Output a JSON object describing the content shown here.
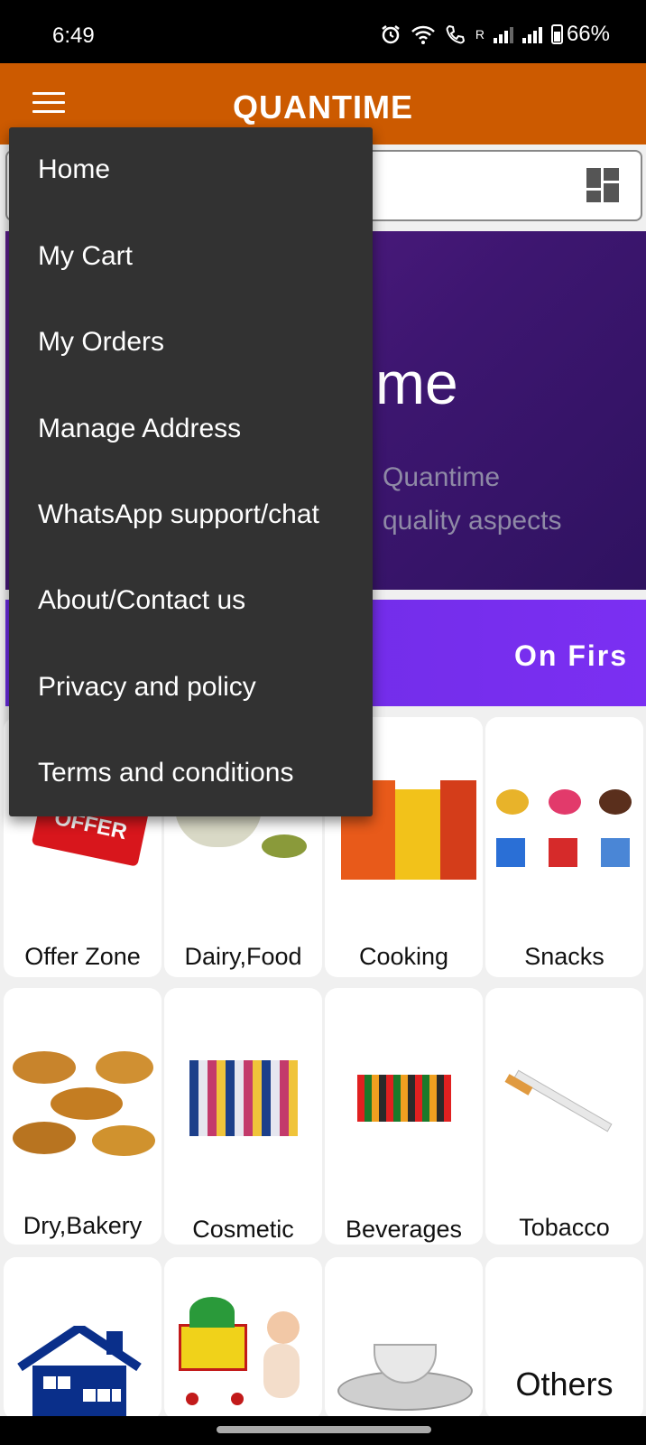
{
  "status_bar": {
    "time": "6:49",
    "net_label": "R",
    "battery": "66%",
    "icons": [
      "alarm-icon",
      "wifi-icon",
      "call-wifi-icon",
      "signal-icon",
      "battery-icon"
    ]
  },
  "app_bar": {
    "title": "QUANTIME",
    "menu_icon": "hamburger-icon",
    "color": "#cc5a00"
  },
  "search": {
    "toggle_icon": "dashboard-grid-icon"
  },
  "banner": {
    "heading_partial": "me",
    "line1_partial": "Quantime",
    "line2_partial": "quality aspects"
  },
  "promo": {
    "text_partial": "On Firs"
  },
  "drawer": {
    "items": [
      "Home",
      "My Cart",
      "My Orders",
      "Manage Address",
      "WhatsApp support/chat",
      "About/Contact us",
      "Privacy and policy",
      "Terms and conditions"
    ]
  },
  "categories": [
    {
      "label": "Offer Zone",
      "image": "special-offer-image",
      "badge": "OFFER"
    },
    {
      "label": "Dairy,Food",
      "image": "grains-bowl-image"
    },
    {
      "label": "Cooking",
      "image": "cooking-products-image"
    },
    {
      "label": "Snacks",
      "image": "snacks-image"
    },
    {
      "label": "Dry,Bakery",
      "image": "bakery-image"
    },
    {
      "label": "Cosmetic",
      "image": "cosmetics-image"
    },
    {
      "label": "Beverages",
      "image": "beverages-image"
    },
    {
      "label": "Tobacco",
      "image": "cigarette-image"
    },
    {
      "label": "",
      "image": "house-image"
    },
    {
      "label": "",
      "image": "baby-shopping-cart-image"
    },
    {
      "label": "",
      "image": "plates-image"
    },
    {
      "label": "Others",
      "image": ""
    }
  ]
}
